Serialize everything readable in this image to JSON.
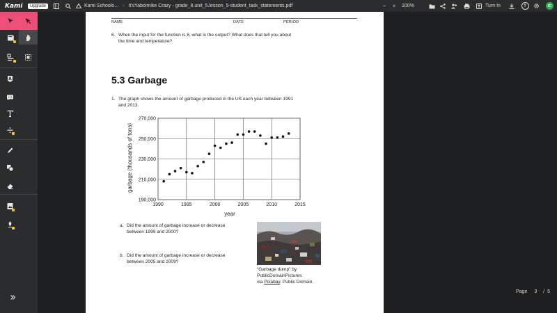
{
  "topbar": {
    "logo": "Kami",
    "upgrade_label": "Upgrade",
    "breadcrumb_folder": "Kami Schoolo...",
    "breadcrumb_file": "It'sYaboimike Crazy - grade_8.unit_5.lesson_5-student_task_statements.pdf",
    "zoom_minus": "−",
    "zoom_level": "100%",
    "zoom_plus": "+",
    "turn_in_label": "Turn In",
    "avatar_initials": "IC"
  },
  "page_indicator": {
    "label": "Page",
    "current": "3",
    "sep": "/",
    "total": "5"
  },
  "document": {
    "header": {
      "name": "NAME",
      "date": "DATE",
      "period": "PERIOD"
    },
    "q6_number": "6.",
    "q6_line1": "When the input for the function is 8, what is the output? What does that tell you about",
    "q6_line2": "the time and temperature?",
    "section_title": "5.3 Garbage",
    "q1_number": "1.",
    "q1_line1": "The graph shows the amount of garbage produced in the US each year between 1991",
    "q1_line2": "and 2013.",
    "qa_letter": "a.",
    "qa_line1": "Did the amount of garbage increase or decrease",
    "qa_line2": "between 1999 and 2000?",
    "qb_letter": "b.",
    "qb_line1": "Did the amount of garbage increase or decrease",
    "qb_line2": "between 2005 and 2009?",
    "caption_line1": "“Garbage dump” by",
    "caption_line2": "PublicDomainPictures",
    "caption_via": "via ",
    "caption_link": "Pixabay",
    "caption_end": ". Public Domain."
  },
  "chart_data": {
    "type": "scatter",
    "xlabel": "year",
    "ylabel": "garbage (thousands of tons)",
    "xlim": [
      1990,
      2015
    ],
    "ylim": [
      190000,
      270000
    ],
    "x_ticks": [
      "1990",
      "1995",
      "2000",
      "2005",
      "2010",
      "2015"
    ],
    "y_ticks": [
      "190,000",
      "210,000",
      "230,000",
      "250,000",
      "270,000"
    ],
    "grid": true,
    "points": [
      {
        "x": 1991,
        "y": 208000
      },
      {
        "x": 1992,
        "y": 215000
      },
      {
        "x": 1993,
        "y": 218000
      },
      {
        "x": 1994,
        "y": 221000
      },
      {
        "x": 1995,
        "y": 217000
      },
      {
        "x": 1996,
        "y": 216000
      },
      {
        "x": 1997,
        "y": 223000
      },
      {
        "x": 1998,
        "y": 227000
      },
      {
        "x": 1999,
        "y": 235000
      },
      {
        "x": 2000,
        "y": 243000
      },
      {
        "x": 2001,
        "y": 241000
      },
      {
        "x": 2002,
        "y": 245000
      },
      {
        "x": 2003,
        "y": 246000
      },
      {
        "x": 2004,
        "y": 254000
      },
      {
        "x": 2005,
        "y": 254000
      },
      {
        "x": 2006,
        "y": 257000
      },
      {
        "x": 2007,
        "y": 257000
      },
      {
        "x": 2008,
        "y": 253000
      },
      {
        "x": 2009,
        "y": 245000
      },
      {
        "x": 2010,
        "y": 251000
      },
      {
        "x": 2011,
        "y": 251000
      },
      {
        "x": 2012,
        "y": 252000
      },
      {
        "x": 2013,
        "y": 255000
      }
    ]
  },
  "icons": {
    "pointer": "select-arrow-icon",
    "hand": "hand-icon",
    "zoom": "search-icon",
    "turn_in": "upload-icon"
  }
}
